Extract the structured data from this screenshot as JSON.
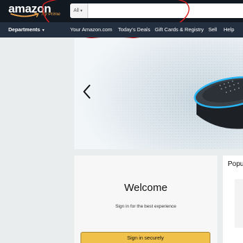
{
  "header": {
    "logo_text": "amazon",
    "logo_tagline": "Try Prime",
    "search": {
      "department": "All",
      "value": "",
      "placeholder": ""
    }
  },
  "nav": {
    "departments_label": "Departments",
    "links": [
      "Your Amazon.com",
      "Today's Deals",
      "Gift Cards & Registry",
      "Sell",
      "Help"
    ]
  },
  "hero": {
    "prev_icon": "chevron-left-icon",
    "product": "echo dot speaker"
  },
  "signin_card": {
    "title": "Welcome",
    "subtitle": "Sign in for the best experience",
    "button_label": "Sign in securely"
  },
  "side_card": {
    "title": "Popu"
  },
  "colors": {
    "topbar": "#131921",
    "navbar": "#232f3e",
    "accent_orange": "#f0a54a",
    "button_yellow": "#f0c14b",
    "annotation_red": "#e02020",
    "echo_ring": "#29b6f6"
  }
}
